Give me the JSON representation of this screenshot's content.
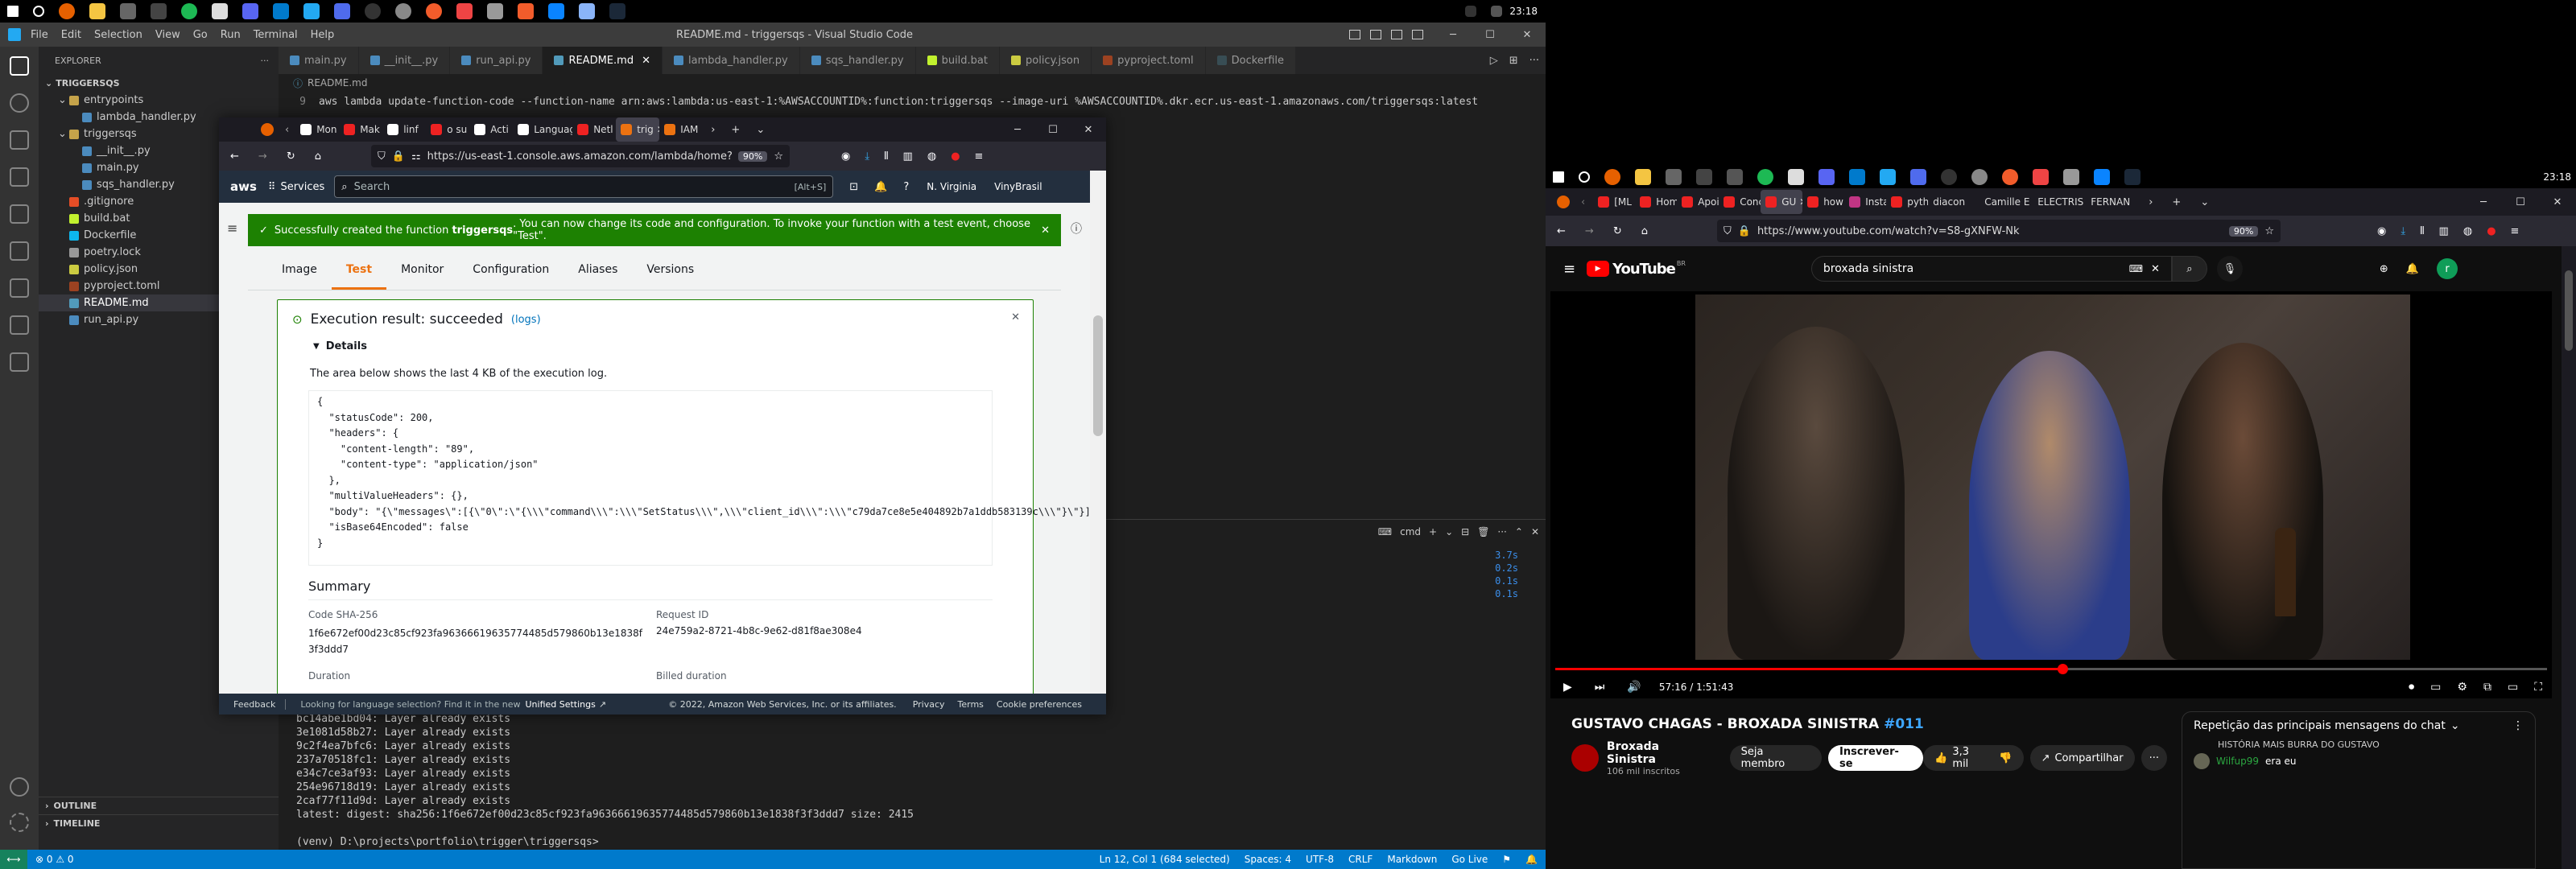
{
  "left_taskbar": {
    "time": "23:18"
  },
  "right_taskbar": {
    "time": "23:18"
  },
  "vscode": {
    "menu": [
      "File",
      "Edit",
      "Selection",
      "View",
      "Go",
      "Run",
      "Terminal",
      "Help"
    ],
    "title": "README.md - triggersqs - Visual Studio Code",
    "explorer_title": "EXPLORER",
    "root": "TRIGGERSQS",
    "tree": [
      {
        "label": "entrypoints",
        "indent": 1,
        "color": "#ccc",
        "icon": "folder"
      },
      {
        "label": "lambda_handler.py",
        "indent": 2,
        "color": "#ccc",
        "icon": "py"
      },
      {
        "label": "triggersqs",
        "indent": 1,
        "color": "#ccc",
        "icon": "folder"
      },
      {
        "label": "__init__.py",
        "indent": 2,
        "color": "#ccc",
        "icon": "py"
      },
      {
        "label": "main.py",
        "indent": 2,
        "color": "#ccc",
        "icon": "py"
      },
      {
        "label": "sqs_handler.py",
        "indent": 2,
        "color": "#ccc",
        "icon": "py"
      },
      {
        "label": ".gitignore",
        "indent": 1,
        "color": "#ccc",
        "icon": "git"
      },
      {
        "label": "build.bat",
        "indent": 1,
        "color": "#ccc",
        "icon": "bat"
      },
      {
        "label": "Dockerfile",
        "indent": 1,
        "color": "#ccc",
        "icon": "docker"
      },
      {
        "label": "poetry.lock",
        "indent": 1,
        "color": "#ccc",
        "icon": "lock"
      },
      {
        "label": "policy.json",
        "indent": 1,
        "color": "#ccc",
        "icon": "json"
      },
      {
        "label": "pyproject.toml",
        "indent": 1,
        "color": "#ccc",
        "icon": "toml"
      },
      {
        "label": "README.md",
        "indent": 1,
        "color": "#fff",
        "icon": "md"
      },
      {
        "label": "run_api.py",
        "indent": 1,
        "color": "#ccc",
        "icon": "py"
      }
    ],
    "outline": "OUTLINE",
    "timeline": "TIMELINE",
    "tabs": [
      {
        "label": "main.py",
        "color": "#4b8bbe"
      },
      {
        "label": "__init__.py",
        "color": "#4b8bbe"
      },
      {
        "label": "run_api.py",
        "color": "#4b8bbe"
      },
      {
        "label": "README.md",
        "color": "#519aba"
      },
      {
        "label": "lambda_handler.py",
        "color": "#4b8bbe"
      },
      {
        "label": "sqs_handler.py",
        "color": "#4b8bbe"
      },
      {
        "label": "build.bat",
        "color": "#c1f12e"
      },
      {
        "label": "policy.json",
        "color": "#cbcb41"
      },
      {
        "label": "pyproject.toml",
        "color": "#9c4221"
      },
      {
        "label": "Dockerfile",
        "color": "#384d54"
      }
    ],
    "breadcrumb": "README.md",
    "editor_line_no": "9",
    "editor_line": "aws lambda update-function-code --function-name arn:aws:lambda:us-east-1:%AWSACCOUNTID%:function:triggersqs --image-uri %AWSACCOUNTID%.dkr.ecr.us-east-1.amazonaws.com/triggersqs:latest",
    "terminal_shell": "cmd",
    "terminal_times": [
      "3.7s",
      "0.2s",
      "0.1s",
      "0.1s"
    ],
    "terminal_lines": [
      "bc14abe1bd04: Layer already exists",
      "3e1081d58b27: Layer already exists",
      "9c2f4ea7bfc6: Layer already exists",
      "237a70518fc1: Layer already exists",
      "e34c7ce3af93: Layer already exists",
      "254e96718d19: Layer already exists",
      "2caf77f11d9d: Layer already exists",
      "latest: digest: sha256:1f6e672ef00d23c85cf923fa96366619635774485d579860b13e1838f3f3ddd7 size: 2415",
      "",
      "(venv) D:\\projects\\portfolio\\trigger\\triggersqs>"
    ],
    "status_left": "⊗ 0 ⚠ 0",
    "status_right": [
      "Ln 12, Col 1 (684 selected)",
      "Spaces: 4",
      "UTF-8",
      "CRLF",
      "Markdown",
      "Go Live"
    ]
  },
  "firefox_aws": {
    "tabs": [
      "Mon",
      "Mak",
      "linf",
      "o su",
      "Acti",
      "Language",
      "Netl",
      "trig",
      "IAM"
    ],
    "url": "https://us-east-1.console.aws.amazon.com/lambda/home?region=u",
    "zoom": "90%",
    "aws_nav": {
      "logo": "aws",
      "services": "Services",
      "search_placeholder": "Search",
      "shortcut": "[Alt+S]",
      "region": "N. Virginia",
      "account": "VinyBrasil"
    },
    "flash": {
      "prefix": "Successfully created the function ",
      "fn": "triggersqs",
      "suffix": ". You can now change its code and configuration. To invoke your function with a test event, choose \"Test\"."
    },
    "tabs_fn": [
      "Image",
      "Test",
      "Monitor",
      "Configuration",
      "Aliases",
      "Versions"
    ],
    "result_title": "Execution result: succeeded",
    "logs_link": "(logs)",
    "details": "Details",
    "details_desc": "The area below shows the last 4 KB of the execution log.",
    "json_lines": [
      "{",
      "  \"statusCode\": 200,",
      "  \"headers\": {",
      "    \"content-length\": \"89\",",
      "    \"content-type\": \"application/json\"",
      "  },",
      "  \"multiValueHeaders\": {},",
      "  \"body\": \"{\\\"messages\\\":[{\\\"0\\\":\\\"{\\\\\\\"command\\\\\\\":\\\\\\\"SetStatus\\\\\\\",\\\\\\\"client_id\\\\\\\":\\\\\\\"c79da7ce8e5e404892b7a1ddb583139c\\\\\\\"}\\\"}]}\",",
      "  \"isBase64Encoded\": false",
      "}"
    ],
    "summary": "Summary",
    "code_sha_label": "Code SHA-256",
    "code_sha": "1f6e672ef00d23c85cf923fa96366619635774485d579860b13e1838f3f3ddd7",
    "request_id_label": "Request ID",
    "request_id": "24e759a2-8721-4b8c-9e62-d81f8ae308e4",
    "duration_label": "Duration",
    "billed_label": "Billed duration",
    "footer": {
      "feedback": "Feedback",
      "lang": "Looking for language selection? Find it in the new",
      "unified": "Unified Settings",
      "copyright": "© 2022, Amazon Web Services, Inc. or its affiliates.",
      "privacy": "Privacy",
      "terms": "Terms",
      "cookie": "Cookie preferences"
    }
  },
  "youtube": {
    "tabs": [
      "[ML S",
      "Hom",
      "Apoi",
      "Conc",
      "GU",
      "how i",
      "Insta",
      "pyth",
      "diacon",
      "Camille E",
      "ELECTRIS",
      "FERNAN"
    ],
    "url": "https://www.youtube.com/watch?v=S8-gXNFW-Nk",
    "zoom": "90%",
    "logo": "YouTube",
    "country": "BR",
    "search_value": "broxada sinistra",
    "avatar_letter": "r",
    "time": "57:16 / 1:51:43",
    "progress": 0.512,
    "video_title": "GUSTAVO CHAGAS - BROXADA SINISTRA ",
    "hashtag": "#011",
    "channel": "Broxada Sinistra",
    "subs": "106 mil inscritos",
    "join": "Seja membro",
    "subscribe": "Inscrever-se",
    "likes": "3,3 mil",
    "share": "Compartilhar",
    "chat_header": "Repetição das principais mensagens do chat",
    "chat_line1": "HISTÓRIA MAIS BURRA DO GUSTAVO",
    "chat_user": "Wilfup99",
    "chat_msg": "era eu"
  }
}
